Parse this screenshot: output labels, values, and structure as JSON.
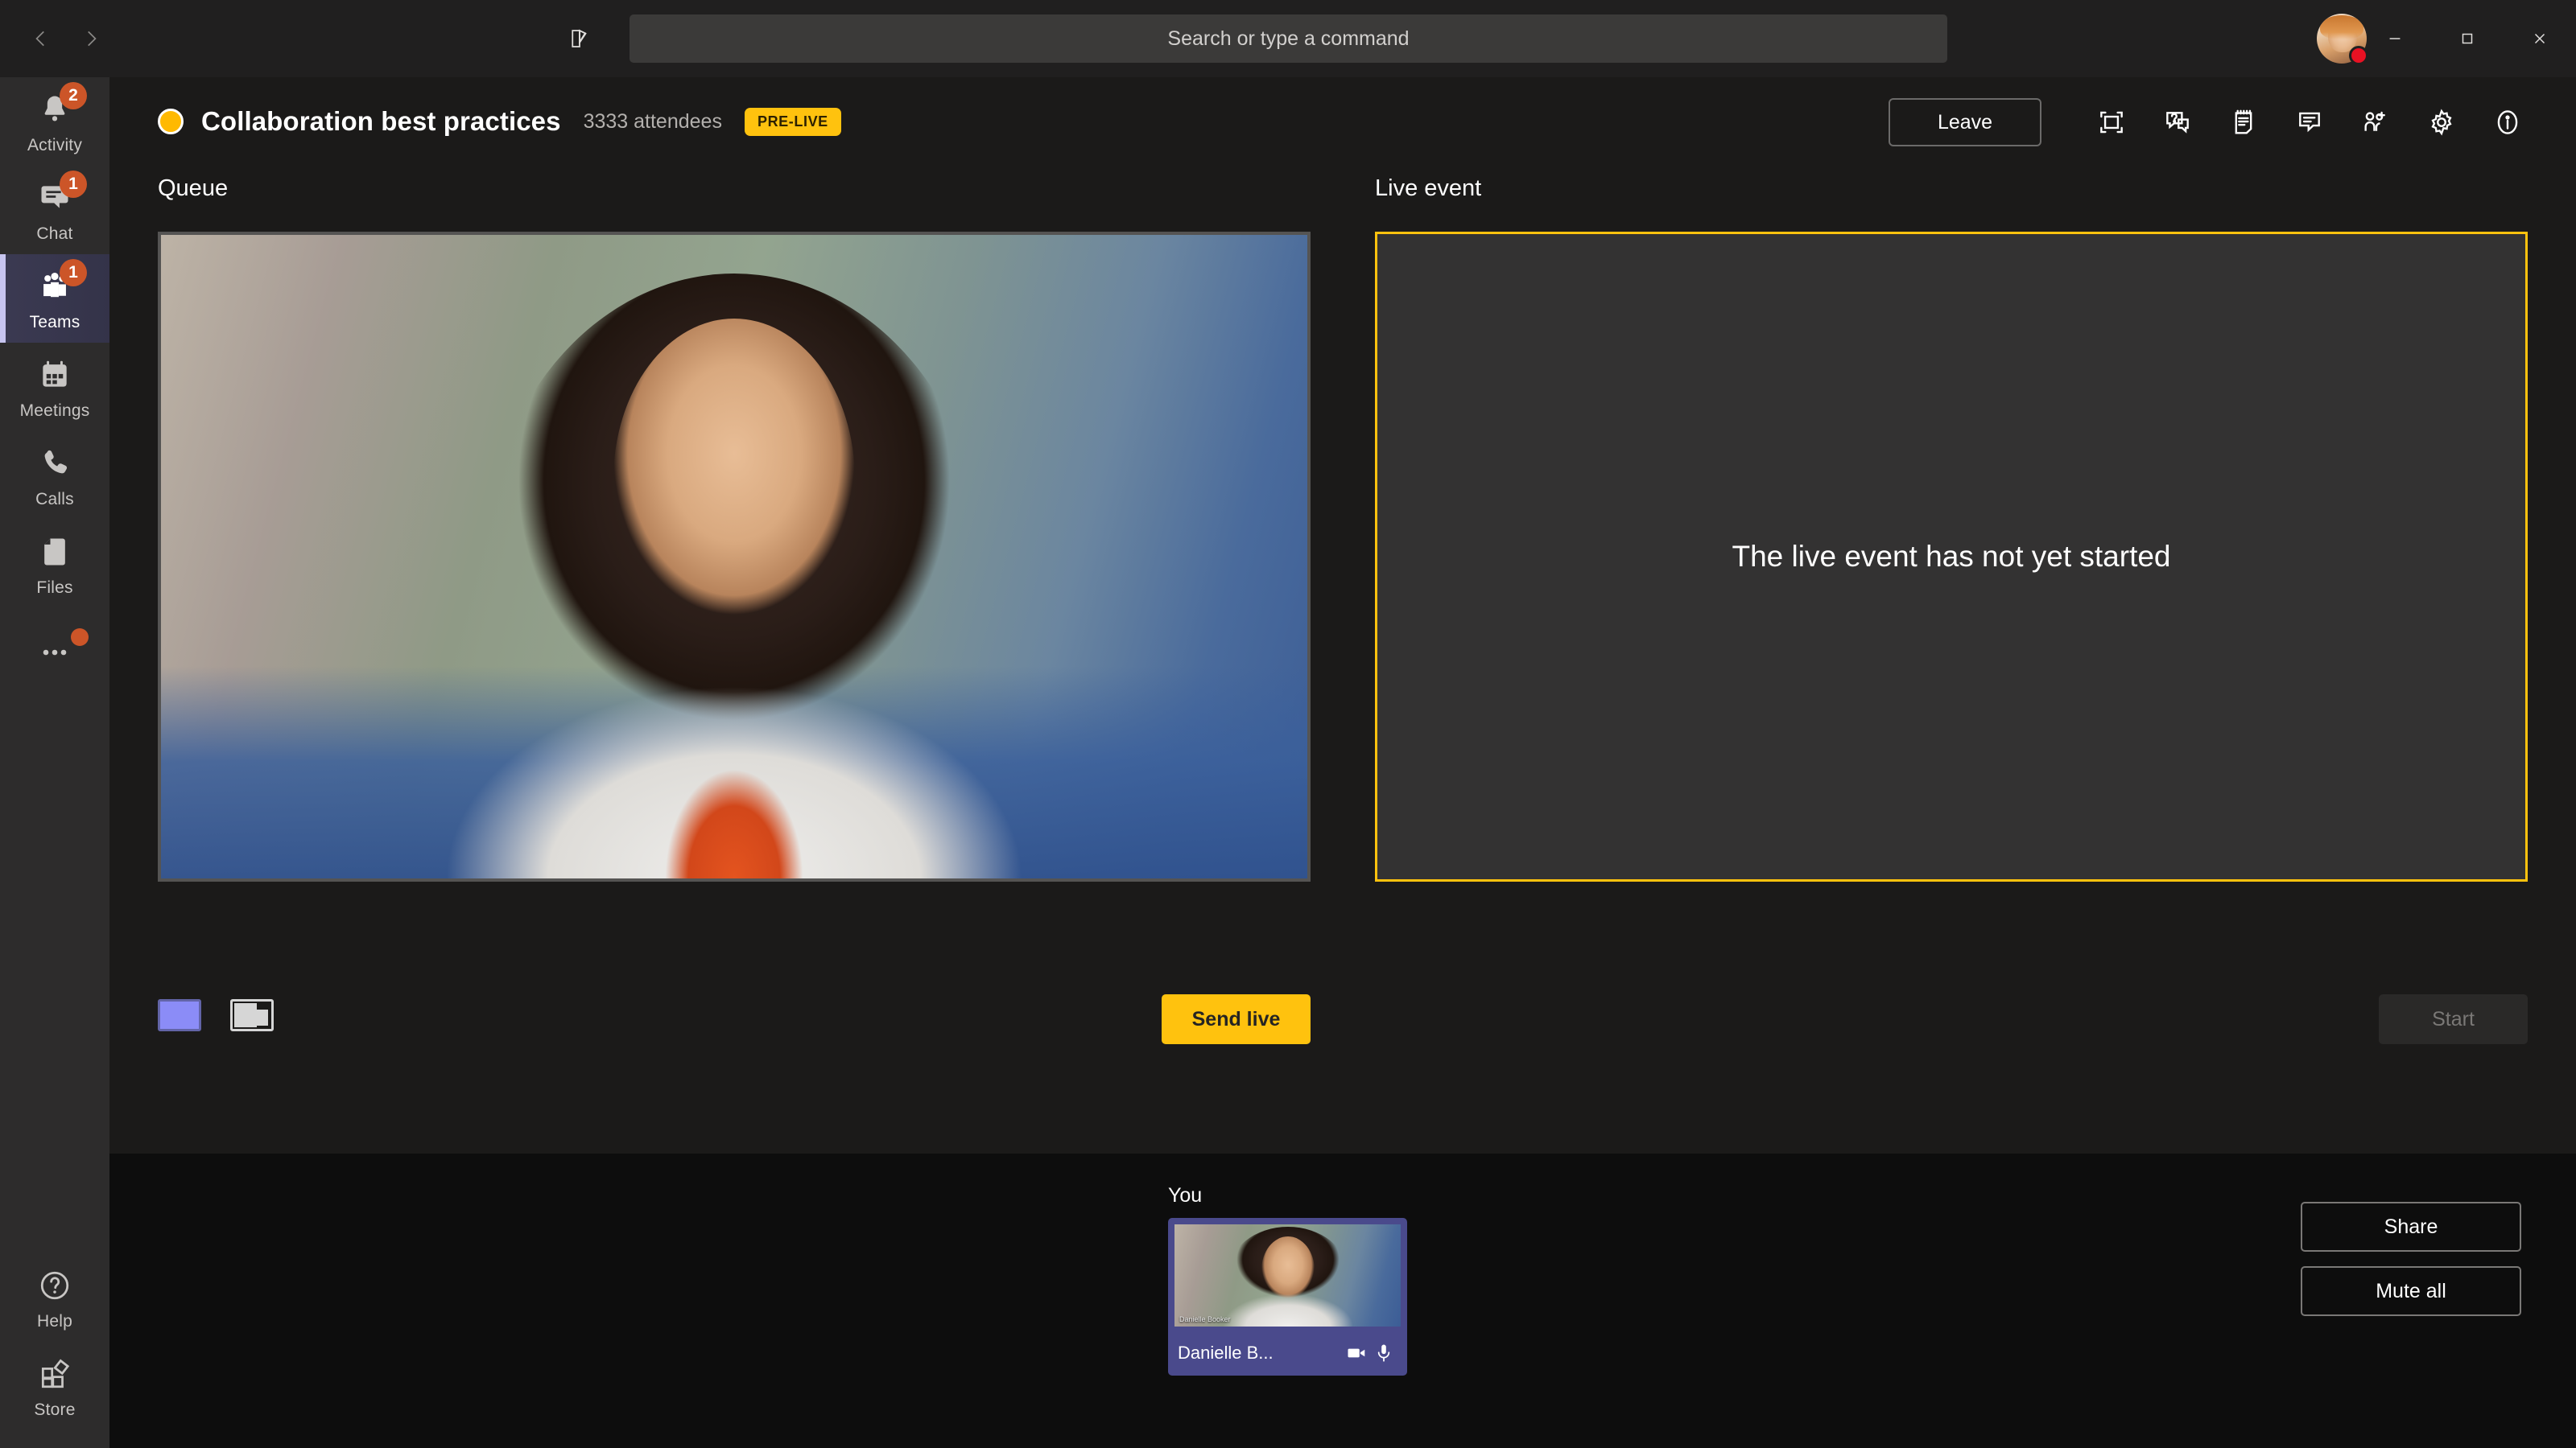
{
  "titlebar": {
    "back_icon": "chevron-left-icon",
    "forward_icon": "chevron-right-icon",
    "compose_icon": "compose-icon",
    "search_placeholder": "Search or type a command",
    "search_value": "",
    "avatar_name": "avatar",
    "presence": "busy",
    "minimize_label": "Minimize",
    "maximize_label": "Maximize",
    "close_label": "Close"
  },
  "rail": {
    "items": [
      {
        "label": "Activity",
        "icon": "bell-icon",
        "badge": "2",
        "active": false
      },
      {
        "label": "Chat",
        "icon": "chat-icon",
        "badge": "1",
        "active": false
      },
      {
        "label": "Teams",
        "icon": "teams-icon",
        "badge": "1",
        "active": true
      },
      {
        "label": "Meetings",
        "icon": "calendar-icon",
        "badge": "",
        "active": false
      },
      {
        "label": "Calls",
        "icon": "phone-icon",
        "badge": "",
        "active": false
      },
      {
        "label": "Files",
        "icon": "file-icon",
        "badge": "",
        "active": false
      },
      {
        "label": "",
        "icon": "ellipsis-icon",
        "badge": "dot",
        "active": false
      }
    ],
    "bottom": [
      {
        "label": "Help",
        "icon": "help-icon"
      },
      {
        "label": "Store",
        "icon": "store-icon"
      }
    ]
  },
  "meeting": {
    "record_indicator": "recording-dot",
    "title": "Collaboration best practices",
    "attendees": "3333 attendees",
    "status_badge": "PRE-LIVE",
    "leave_label": "Leave",
    "tools": [
      {
        "name": "fullscreen-icon",
        "label": "Full screen"
      },
      {
        "name": "qna-icon",
        "label": "Q&A"
      },
      {
        "name": "notes-icon",
        "label": "Meeting notes"
      },
      {
        "name": "chat-icon",
        "label": "Chat"
      },
      {
        "name": "add-people-icon",
        "label": "Add participants"
      },
      {
        "name": "gear-icon",
        "label": "Device settings"
      },
      {
        "name": "info-icon",
        "label": "Event info"
      }
    ]
  },
  "panels": {
    "queue_label": "Queue",
    "live_label": "Live event",
    "live_message": "The live event has not yet started",
    "send_live_label": "Send live",
    "start_label": "Start",
    "layouts": [
      {
        "name": "layout-single",
        "selected": true
      },
      {
        "name": "layout-split",
        "selected": false
      }
    ]
  },
  "bottom": {
    "you_label": "You",
    "participant_name": "Danielle B...",
    "video_icon": "camera-icon",
    "mic_icon": "microphone-icon",
    "video_watermark": "Danielle Booker",
    "share_label": "Share",
    "mute_all_label": "Mute all"
  },
  "colors": {
    "accent_yellow": "#ffc20e",
    "brand_purple": "#6264a7",
    "badge_orange": "#cc5528",
    "presence_busy": "#e81123"
  }
}
